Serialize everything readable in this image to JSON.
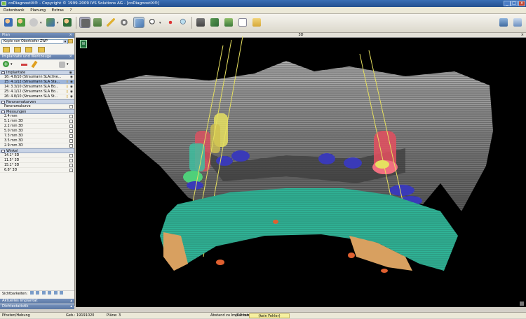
{
  "window": {
    "title": "coDiagnostiX® - Copyright © 1999-2009 IVS Solutions AG - [coDiagnostiX®]"
  },
  "menu": [
    "Datenbank",
    "Planung",
    "Extras",
    "?"
  ],
  "left": {
    "plan_header": "Plan",
    "plan_select": "Kopie von Oberkiefer ZWP",
    "implants_header": "Implantate und Werkzeuge",
    "implants_section": "Implantate",
    "implants": [
      {
        "label": "16: 4.8/10 (Straumann SLActive...",
        "selected": false,
        "warn": false
      },
      {
        "label": "15: 4.1/12 (Straumann SLA Sta...",
        "selected": true,
        "warn": true
      },
      {
        "label": "14: 3.3/10 (Straumann SLA Bo...",
        "selected": false,
        "warn": true
      },
      {
        "label": "25: 4.1/12 (Straumann SLA Bo...",
        "selected": false,
        "warn": true
      },
      {
        "label": "26: 4.8/10 (Straumann SLA St...",
        "selected": false,
        "warn": true
      }
    ],
    "panorama_section": "Panoramakurven",
    "panorama_items": [
      "Panoramakurve"
    ],
    "measurements_section": "Messungen",
    "measurements": [
      "2.4 mm",
      "5.1 mm 3D",
      "2.2 mm 3D",
      "5.0 mm 3D",
      "7.3 mm 3D",
      "3.5 mm 3D",
      "2.9 mm 3D"
    ],
    "angles_section": "Winkel",
    "angles": [
      "14.1° 3D",
      "11.5° 3D",
      "15.1° 3D",
      "6.8° 3D"
    ],
    "visibility_label": "Sichtbarkeiten:",
    "current_implant": "Aktuelles Implantat",
    "density_stats": "Dichtestatistik"
  },
  "viewport": {
    "label": "3D",
    "overlay_label": "N"
  },
  "status": {
    "left": "Pfosten/Hebung",
    "geo": "Geb.: 19191020",
    "plans": "Pläne: 3",
    "distance": "Abstand zu Implantaten:",
    "distance_value": "3.0 mm",
    "box": "(kein Fehler)"
  },
  "colors": {
    "titlebar": "#2e5e9f",
    "implant_red": "#e05060",
    "implant_yellow": "#e6e060",
    "implant_green": "#4fd07a",
    "bone": "#8a8a8a",
    "mandible_teal": "#2fb598",
    "blue_teeth": "#3a3ab8"
  },
  "icons": [
    "patient-icon",
    "patient-add-icon",
    "export-icon",
    "transfer-icon",
    "user-icon",
    "slice-view-icon",
    "layout-icon",
    "ruler-icon",
    "gear-icon",
    "cube-icon",
    "zoom-icon",
    "locate-icon",
    "search-icon",
    "implant-icon",
    "layers-icon",
    "screenshot-icon",
    "document-icon",
    "folder-icon",
    "monitor-icon",
    "window-icon"
  ]
}
